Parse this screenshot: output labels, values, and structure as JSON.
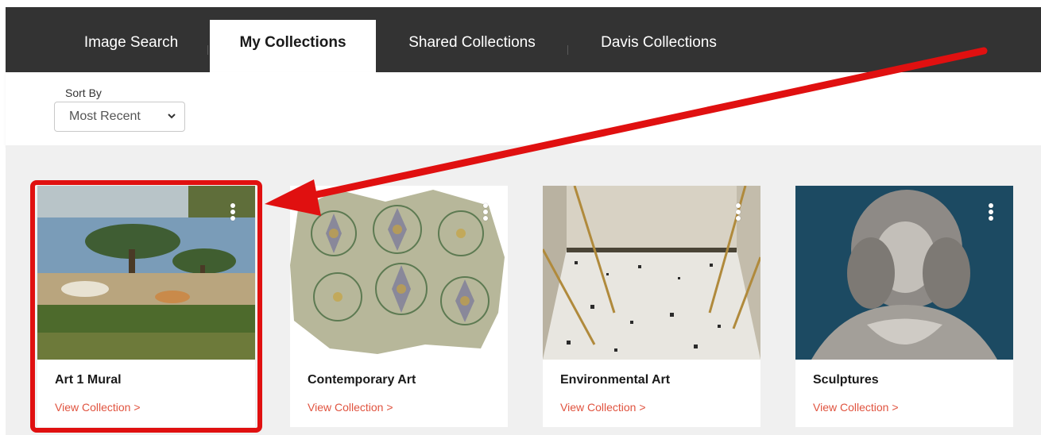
{
  "nav": {
    "tabs": [
      {
        "label": "Image Search",
        "active": false
      },
      {
        "label": "My Collections",
        "active": true
      },
      {
        "label": "Shared Collections",
        "active": false
      },
      {
        "label": "Davis Collections",
        "active": false
      }
    ]
  },
  "sort": {
    "label": "Sort By",
    "selected": "Most Recent",
    "icon": "chevron-down-icon"
  },
  "collections": [
    {
      "title": "Art 1 Mural",
      "link": "View Collection >",
      "menu_icon": "more-vertical-icon",
      "highlighted": true
    },
    {
      "title": "Contemporary Art",
      "link": "View Collection >",
      "menu_icon": "more-vertical-icon",
      "highlighted": false
    },
    {
      "title": "Environmental Art",
      "link": "View Collection >",
      "menu_icon": "more-vertical-icon",
      "highlighted": false
    },
    {
      "title": "Sculptures",
      "link": "View Collection >",
      "menu_icon": "more-vertical-icon",
      "highlighted": false
    }
  ],
  "colors": {
    "nav_bg": "#333333",
    "link": "#e0533f",
    "annotation": "#e01010",
    "grid_bg": "#f0f0f0"
  }
}
